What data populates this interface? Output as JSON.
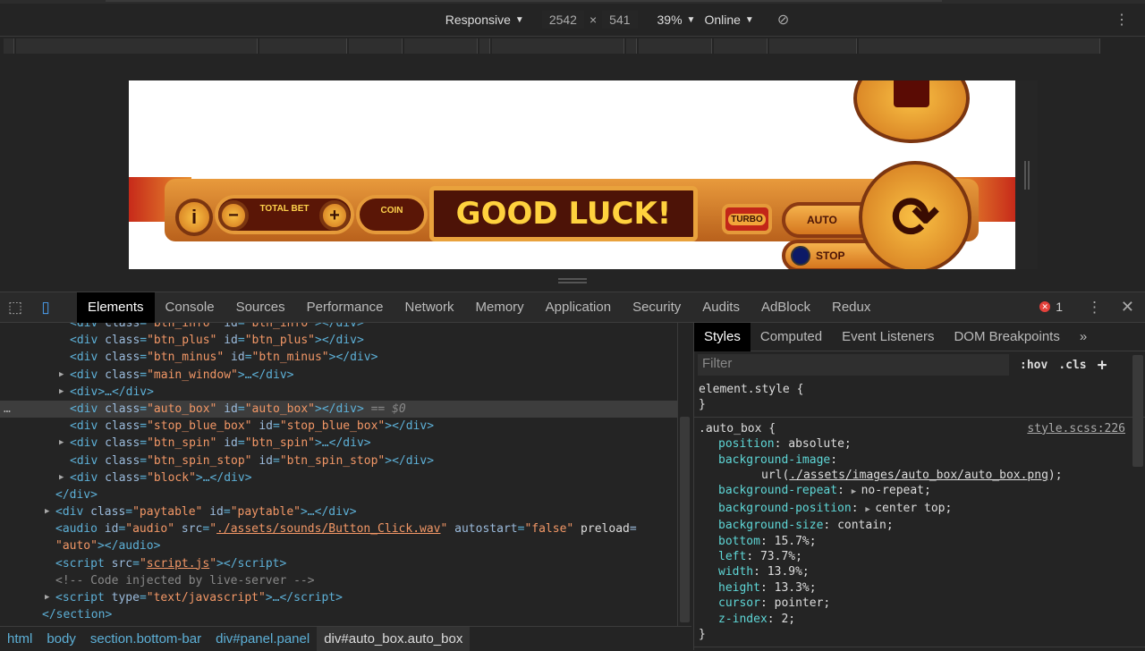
{
  "device_toolbar": {
    "device": "Responsive",
    "width": "2542",
    "times": "×",
    "height": "541",
    "zoom": "39%",
    "throttle": "Online"
  },
  "game": {
    "total_bet": "TOTAL BET",
    "coin": "COIN",
    "good_luck": "GOOD LUCK!",
    "turbo": "TURBO",
    "auto": "AUTO",
    "stop": "STOP",
    "info": "i",
    "minus": "−",
    "plus": "+"
  },
  "devtools": {
    "tabs": [
      "Elements",
      "Console",
      "Sources",
      "Performance",
      "Network",
      "Memory",
      "Application",
      "Security",
      "Audits",
      "AdBlock",
      "Redux"
    ],
    "error_count": "1",
    "elements": [
      {
        "indent": 78,
        "html": "<div class=\"btn_info\" id=\"btn_info\"></div>"
      },
      {
        "indent": 78,
        "html": "<div class=\"btn_plus\" id=\"btn_plus\"></div>"
      },
      {
        "indent": 78,
        "html": "<div class=\"btn_minus\" id=\"btn_minus\"></div>"
      },
      {
        "indent": 78,
        "tri": true,
        "html": "<div class=\"main_window\">…</div>"
      },
      {
        "indent": 78,
        "tri": true,
        "html": "<div>…</div>"
      },
      {
        "indent": 78,
        "sel": true,
        "html": "<div class=\"auto_box\" id=\"auto_box\"></div>",
        "suffix": " == $0"
      },
      {
        "indent": 78,
        "html": "<div class=\"stop_blue_box\" id=\"stop_blue_box\"></div>"
      },
      {
        "indent": 78,
        "tri": true,
        "html": "<div class=\"btn_spin\" id=\"btn_spin\">…</div>"
      },
      {
        "indent": 78,
        "html": "<div class=\"btn_spin_stop\" id=\"btn_spin_stop\"></div>"
      },
      {
        "indent": 78,
        "tri": true,
        "html": "<div class=\"block\">…</div>"
      },
      {
        "indent": 62,
        "html": "</div>"
      },
      {
        "indent": 62,
        "tri": true,
        "html": "<div class=\"paytable\" id=\"paytable\">…</div>"
      },
      {
        "indent": 62,
        "html": "<audio id=\"audio\" src=\"./assets/sounds/Button_Click.wav\" autostart=\"false\" preload="
      },
      {
        "indent": 62,
        "html": "\"auto\"></audio>"
      },
      {
        "indent": 62,
        "html": "<script src=\"script.js\"></script>"
      },
      {
        "indent": 62,
        "comment": true,
        "html": "<!-- Code injected by live-server -->"
      },
      {
        "indent": 62,
        "tri": true,
        "html": "<script type=\"text/javascript\">…</script>"
      },
      {
        "indent": 47,
        "html": "</section>"
      }
    ],
    "breadcrumbs": [
      "html",
      "body",
      "section.bottom-bar",
      "div#panel.panel",
      "div#auto_box.auto_box"
    ],
    "styles": {
      "tabs": [
        "Styles",
        "Computed",
        "Event Listeners",
        "DOM Breakpoints",
        "»"
      ],
      "filter_placeholder": "Filter",
      "hov": ":hov",
      "cls": ".cls",
      "add": "+",
      "element_style": "element.style {",
      "close": "}",
      "selector": ".auto_box {",
      "source": "style.scss:226",
      "props": [
        {
          "n": "position",
          "v": "absolute;"
        },
        {
          "n": "background-image",
          "v": ""
        },
        {
          "n": "",
          "v": "url(./assets/images/auto_box/auto_box.png);",
          "url": true
        },
        {
          "n": "background-repeat",
          "v": "no-repeat;",
          "tri": true
        },
        {
          "n": "background-position",
          "v": "center top;",
          "tri": true
        },
        {
          "n": "background-size",
          "v": "contain;"
        },
        {
          "n": "bottom",
          "v": "15.7%;"
        },
        {
          "n": "left",
          "v": "73.7%;"
        },
        {
          "n": "width",
          "v": "13.9%;"
        },
        {
          "n": "height",
          "v": "13.3%;"
        },
        {
          "n": "cursor",
          "v": "pointer;"
        },
        {
          "n": "z-index",
          "v": "2;"
        }
      ]
    }
  }
}
